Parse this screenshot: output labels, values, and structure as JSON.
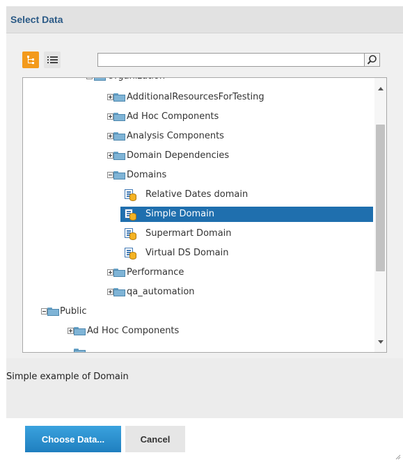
{
  "dialog": {
    "title": "Select Data"
  },
  "toolbar": {
    "tree_view_icon": "tree-view-icon",
    "list_view_icon": "list-view-icon",
    "search": {
      "value": "",
      "placeholder": ""
    },
    "search_icon": "search-icon"
  },
  "tree": {
    "items": [
      {
        "label": "Organization",
        "type": "folder",
        "expanded": true,
        "level": 2
      },
      {
        "label": "AdditionalResourcesForTesting",
        "type": "folder",
        "expanded": false,
        "level": 3
      },
      {
        "label": "Ad Hoc Components",
        "type": "folder",
        "expanded": false,
        "level": 3
      },
      {
        "label": "Analysis Components",
        "type": "folder",
        "expanded": false,
        "level": 3
      },
      {
        "label": "Domain Dependencies",
        "type": "folder",
        "expanded": false,
        "level": 3
      },
      {
        "label": "Domains",
        "type": "folder",
        "expanded": true,
        "level": 3
      },
      {
        "label": "Relative Dates domain",
        "type": "domain",
        "level": 4
      },
      {
        "label": "Simple Domain",
        "type": "domain",
        "level": 4,
        "selected": true
      },
      {
        "label": "Supermart Domain",
        "type": "domain",
        "level": 4
      },
      {
        "label": "Virtual DS Domain",
        "type": "domain",
        "level": 4
      },
      {
        "label": "Performance",
        "type": "folder",
        "expanded": false,
        "level": 3
      },
      {
        "label": "qa_automation",
        "type": "folder",
        "expanded": false,
        "level": 3
      },
      {
        "label": "Public",
        "type": "folder",
        "expanded": true,
        "level": 1
      },
      {
        "label": "Ad Hoc Components",
        "type": "folder",
        "expanded": false,
        "level": 2
      }
    ]
  },
  "description": {
    "text": "Simple example of Domain"
  },
  "footer": {
    "choose_label": "Choose Data...",
    "cancel_label": "Cancel"
  },
  "colors": {
    "accent": "#f39a1c",
    "selection": "#1f6fae",
    "title": "#2b5a86",
    "primary_button": "#2a8fd0"
  }
}
